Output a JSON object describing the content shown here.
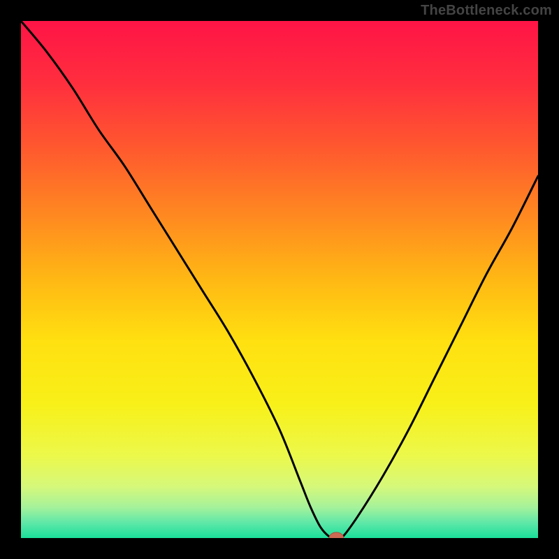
{
  "watermark": "TheBottleneck.com",
  "colors": {
    "frame": "#000000",
    "gradient_stops": [
      {
        "offset": 0.0,
        "color": "#ff1446"
      },
      {
        "offset": 0.12,
        "color": "#ff2e3e"
      },
      {
        "offset": 0.25,
        "color": "#ff5a2e"
      },
      {
        "offset": 0.38,
        "color": "#ff8a20"
      },
      {
        "offset": 0.5,
        "color": "#ffb814"
      },
      {
        "offset": 0.62,
        "color": "#ffe010"
      },
      {
        "offset": 0.74,
        "color": "#f8f018"
      },
      {
        "offset": 0.84,
        "color": "#ecf84a"
      },
      {
        "offset": 0.9,
        "color": "#d6f87a"
      },
      {
        "offset": 0.94,
        "color": "#a6f29a"
      },
      {
        "offset": 0.97,
        "color": "#60e8a8"
      },
      {
        "offset": 1.0,
        "color": "#1adf9a"
      }
    ],
    "curve_stroke": "#000000",
    "marker_fill": "#cd6a54",
    "marker_stroke": "#a6533f"
  },
  "chart_data": {
    "type": "line",
    "title": "",
    "xlabel": "",
    "ylabel": "",
    "xlim": [
      0,
      100
    ],
    "ylim": [
      0,
      100
    ],
    "grid": false,
    "legend": false,
    "series": [
      {
        "name": "bottleneck-curve",
        "x": [
          0,
          5,
          10,
          15,
          20,
          25,
          30,
          35,
          40,
          45,
          50,
          54,
          56,
          58,
          60,
          61,
          62,
          65,
          70,
          75,
          80,
          85,
          90,
          95,
          100
        ],
        "y": [
          100,
          94,
          87,
          79,
          72,
          64,
          56,
          48,
          40,
          31,
          21,
          11,
          6,
          2,
          0,
          0,
          0,
          4,
          12,
          21,
          31,
          41,
          51,
          60,
          70
        ]
      }
    ],
    "marker": {
      "x": 61,
      "y": 0,
      "rx": 1.4,
      "ry": 1.1
    }
  }
}
